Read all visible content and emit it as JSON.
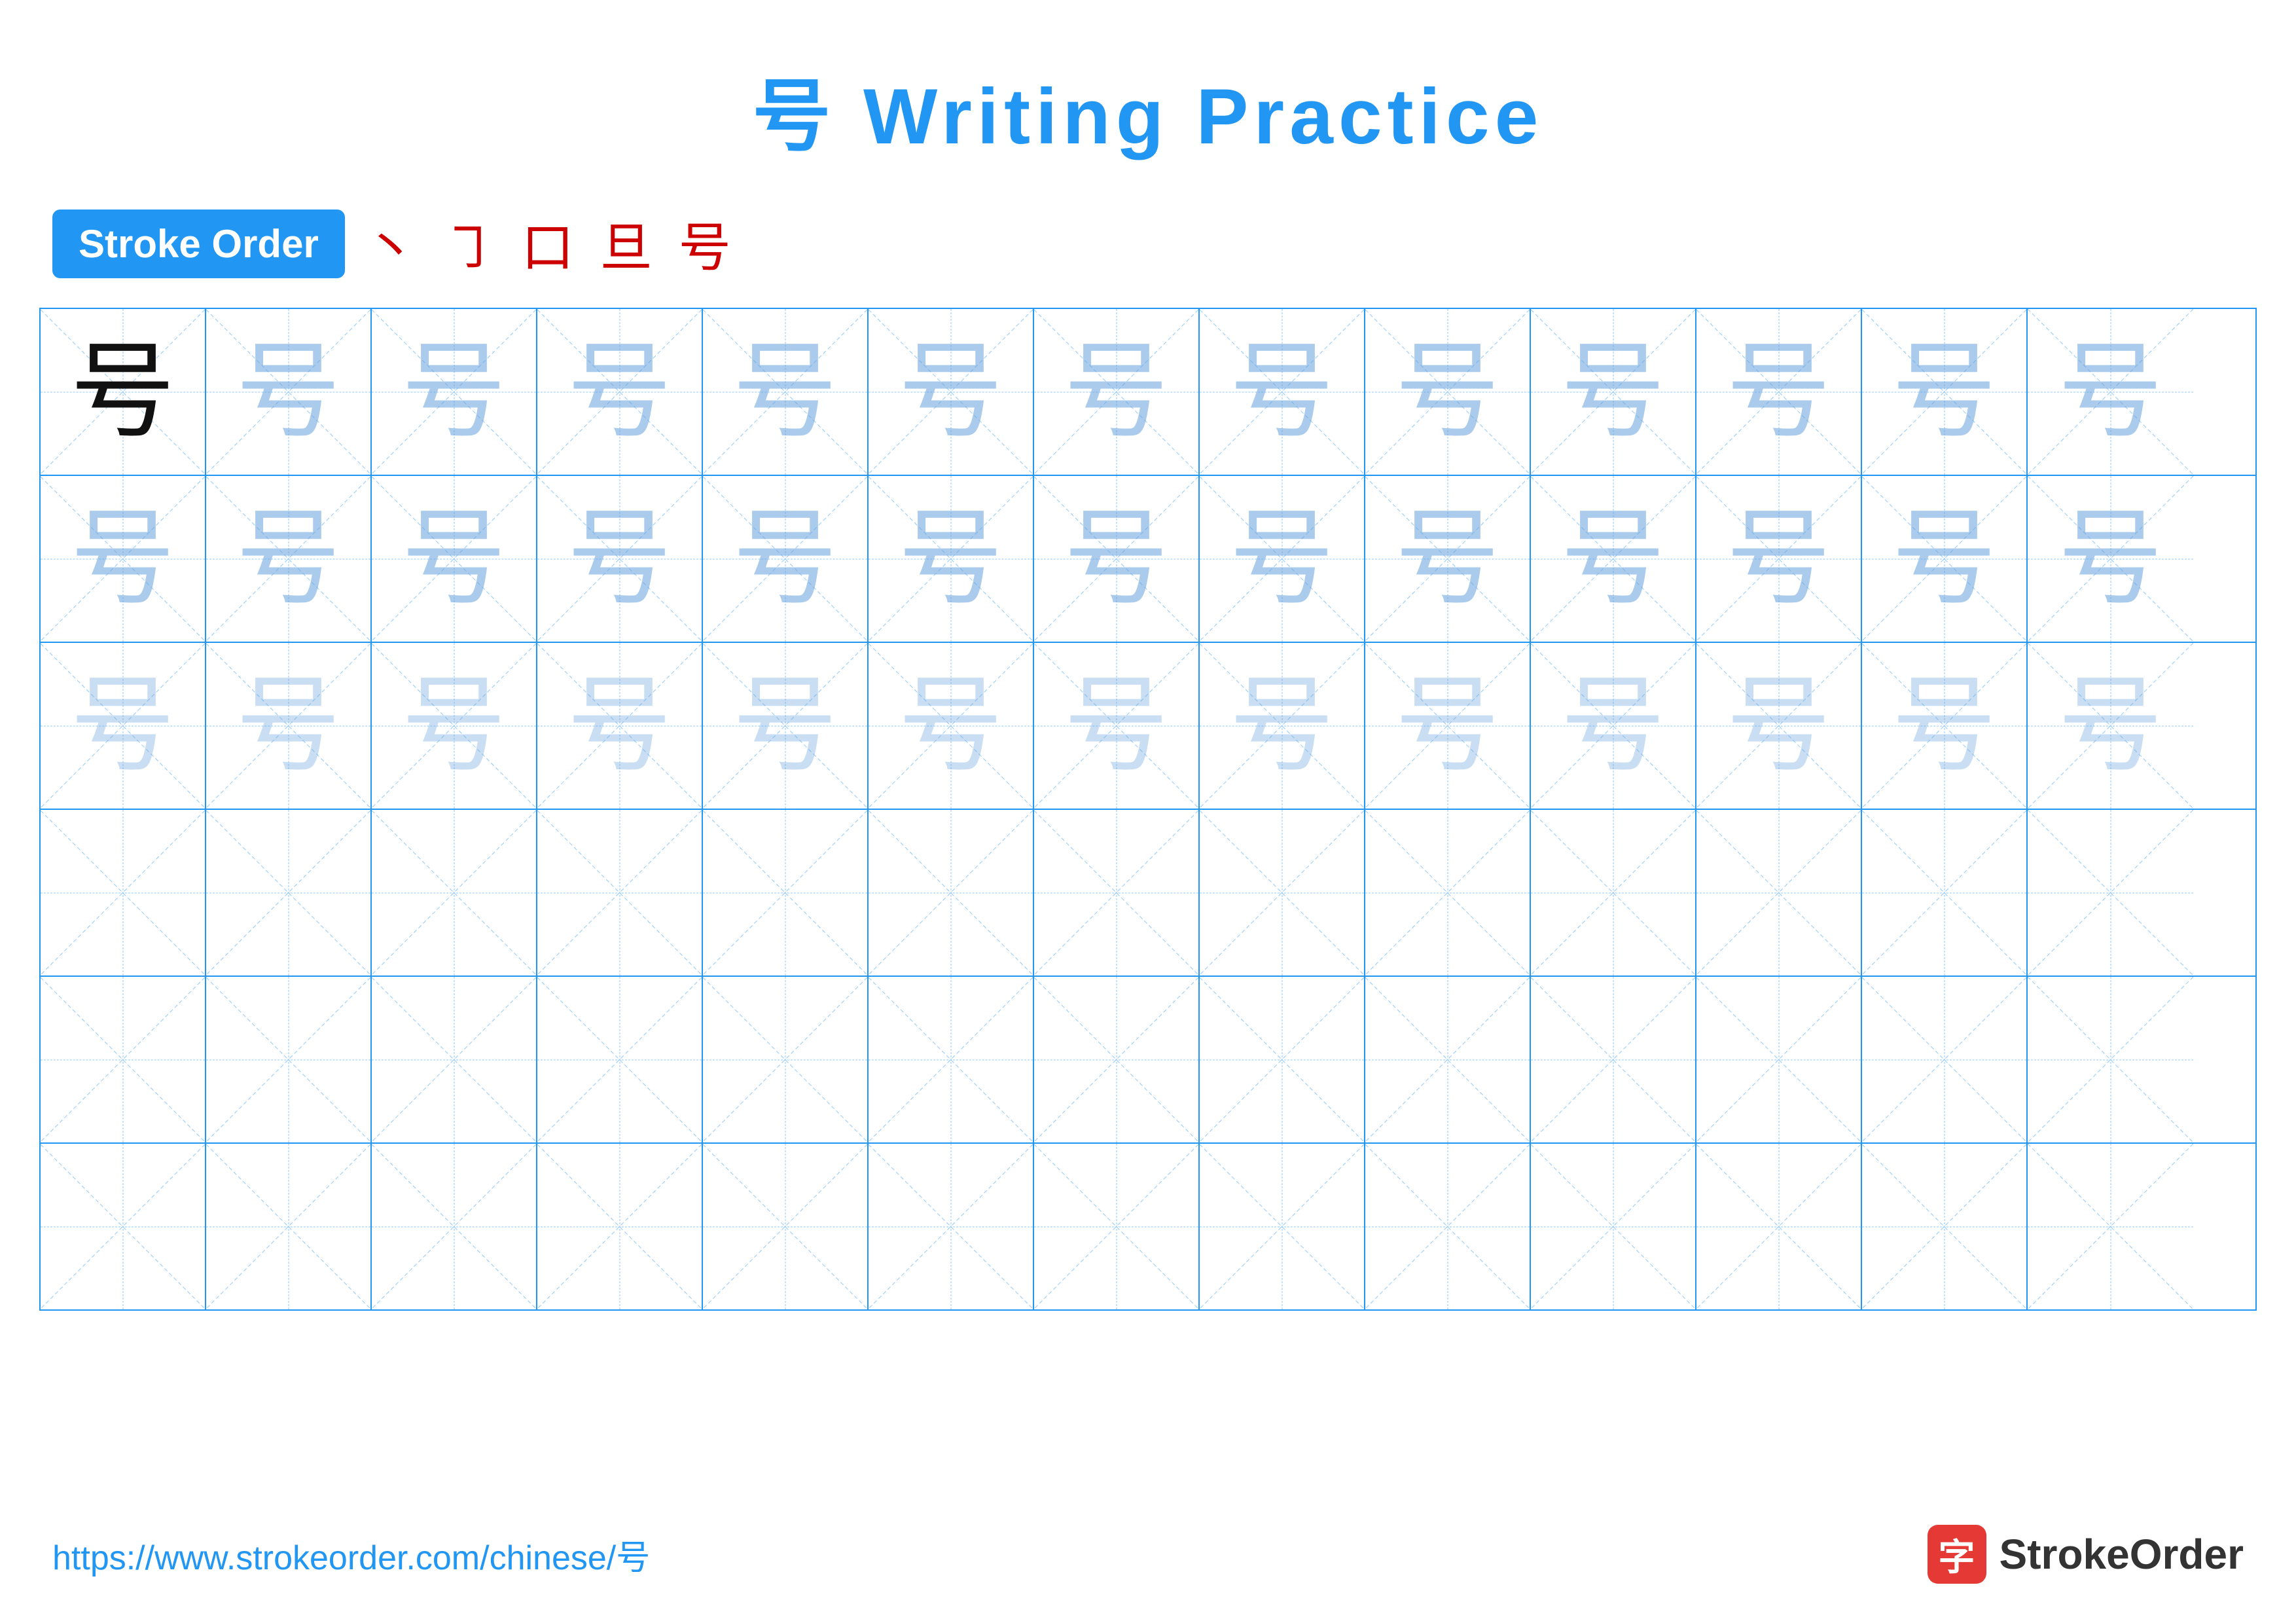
{
  "title": {
    "char": "号",
    "label": " Writing Practice"
  },
  "stroke_order": {
    "badge_label": "Stroke Order",
    "strokes": [
      "丶",
      "㇆",
      "口",
      "旦",
      "号"
    ]
  },
  "grid": {
    "rows": 6,
    "cols": 13,
    "char": "号"
  },
  "footer": {
    "url": "https://www.strokeorder.com/chinese/号",
    "brand_name": "StrokeOrder",
    "brand_char": "字"
  }
}
